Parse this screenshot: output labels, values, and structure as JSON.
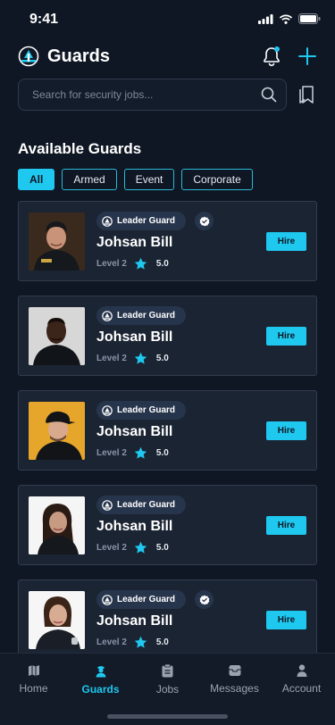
{
  "status_bar": {
    "time": "9:41"
  },
  "header": {
    "title": "Guards"
  },
  "search": {
    "placeholder": "Search for security jobs..."
  },
  "section_title": "Available Guards",
  "filters": [
    {
      "label": "All",
      "active": true
    },
    {
      "label": "Armed",
      "active": false
    },
    {
      "label": "Event",
      "active": false
    },
    {
      "label": "Corporate",
      "active": false
    }
  ],
  "guards": [
    {
      "badge": "Leader Guard",
      "verified": true,
      "name": "Johsan Bill",
      "level": "Level 2",
      "rating": "5.0",
      "hire_label": "Hire"
    },
    {
      "badge": "Leader Guard",
      "verified": false,
      "name": "Johsan Bill",
      "level": "Level 2",
      "rating": "5.0",
      "hire_label": "Hire"
    },
    {
      "badge": "Leader Guard",
      "verified": false,
      "name": "Johsan Bill",
      "level": "Level 2",
      "rating": "5.0",
      "hire_label": "Hire"
    },
    {
      "badge": "Leader Guard",
      "verified": false,
      "name": "Johsan Bill",
      "level": "Level 2",
      "rating": "5.0",
      "hire_label": "Hire"
    },
    {
      "badge": "Leader Guard",
      "verified": true,
      "name": "Johsan Bill",
      "level": "Level 2",
      "rating": "5.0",
      "hire_label": "Hire"
    }
  ],
  "nav": [
    {
      "label": "Home",
      "icon": "map-icon",
      "active": false
    },
    {
      "label": "Guards",
      "icon": "guard-icon",
      "active": true
    },
    {
      "label": "Jobs",
      "icon": "jobs-icon",
      "active": false
    },
    {
      "label": "Messages",
      "icon": "messages-icon",
      "active": false
    },
    {
      "label": "Account",
      "icon": "account-icon",
      "active": false
    }
  ],
  "colors": {
    "background": "#0f1724",
    "card": "#1b2433",
    "accent": "#1ec8ef",
    "badge": "#27354c"
  }
}
